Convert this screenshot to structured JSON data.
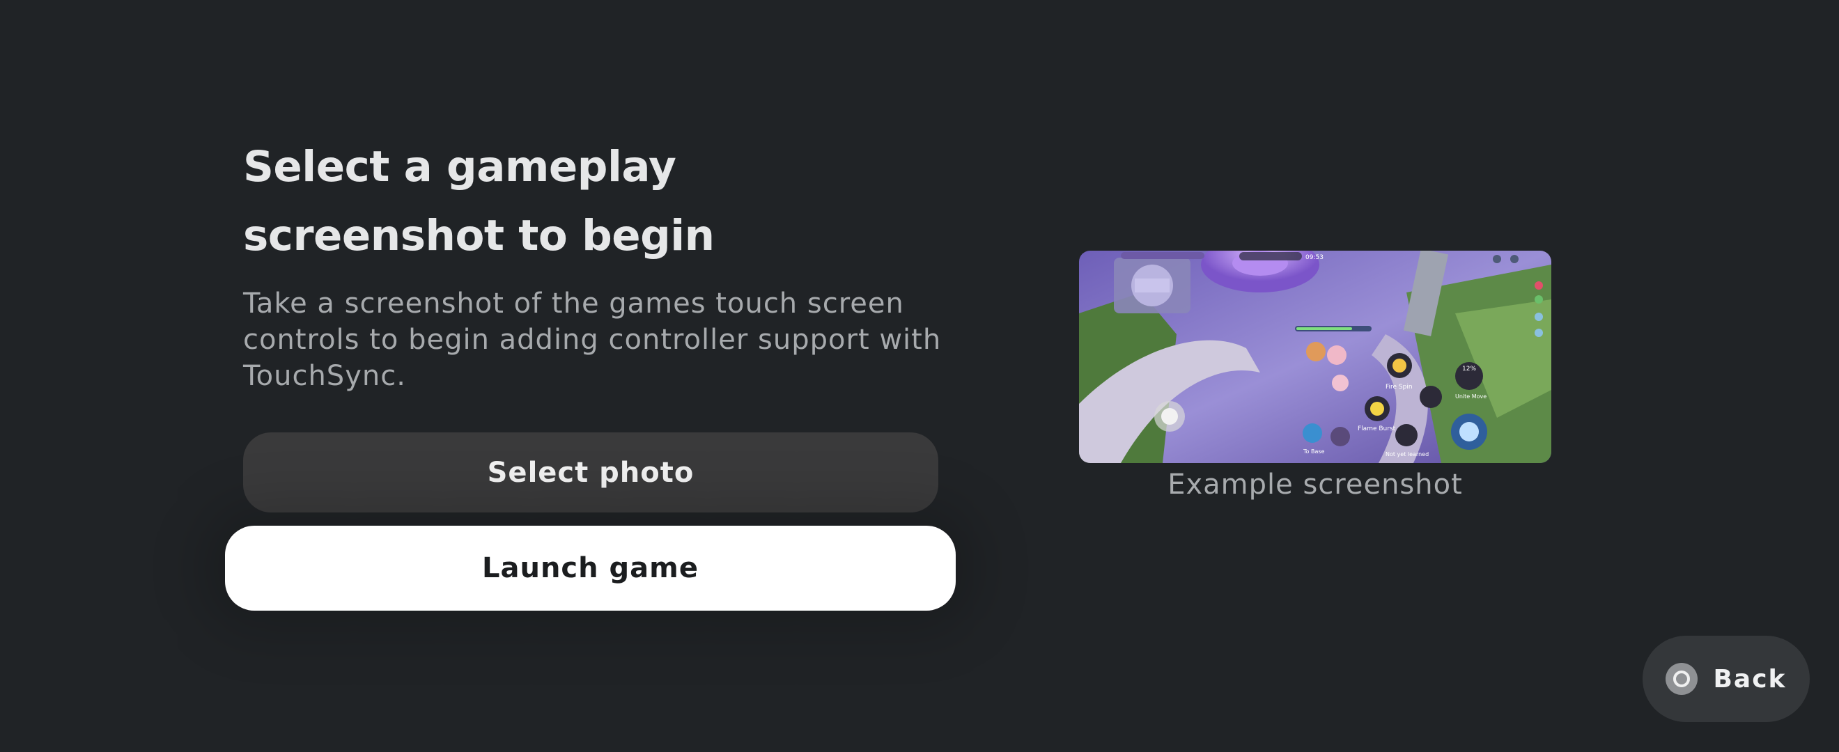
{
  "main": {
    "title": "Select a gameplay screenshot to begin",
    "subtitle": "Take a screenshot of the games touch screen controls to begin adding controller support with TouchSync.",
    "select_photo_label": "Select photo",
    "launch_game_label": "Launch game"
  },
  "example": {
    "caption": "Example screenshot",
    "image_label_fire_spin": "Fire Spin",
    "image_label_flame_burst": "Flame Burst",
    "image_label_unite_move": "Unite Move",
    "image_label_to_base": "To Base",
    "image_label_not_learned": "Not yet learned",
    "image_timer": "09:53",
    "image_unite_percent": "12%"
  },
  "footer": {
    "back_label": "Back"
  },
  "colors": {
    "background": "#202326",
    "select_button": "#3a3a3b",
    "launch_button": "#ffffff",
    "back_button": "#34373a"
  }
}
